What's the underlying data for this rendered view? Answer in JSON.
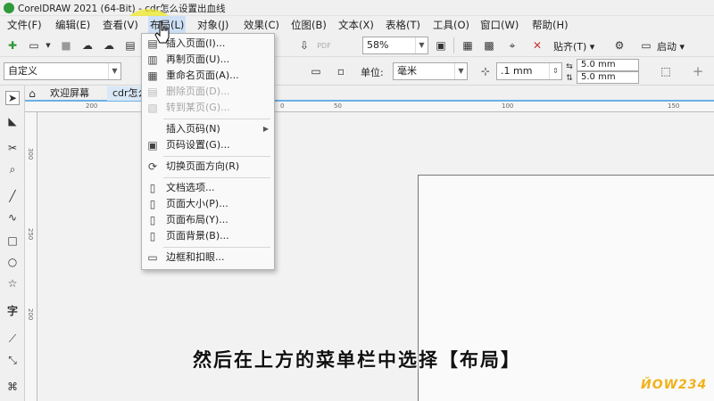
{
  "app": {
    "title": "CorelDRAW 2021 (64-Bit) - cdr怎么设置出血线"
  },
  "menu": {
    "items": [
      "文件(F)",
      "编辑(E)",
      "查看(V)",
      "布局(L)",
      "对象(J)",
      "效果(C)",
      "位图(B)",
      "文本(X)",
      "表格(T)",
      "工具(O)",
      "窗口(W)",
      "帮助(H)"
    ],
    "active_index": 3
  },
  "toolbar": {
    "zoom": "58%",
    "snap_label": "贴齐(T)",
    "launch_label": "启动"
  },
  "property_bar": {
    "page_size": "自定义",
    "unit_label": "单位:",
    "unit_value": "毫米",
    "nudge": ".1 mm",
    "dup_x": "5.0 mm",
    "dup_y": "5.0 mm"
  },
  "doc_tabs": {
    "welcome": "欢迎屏幕",
    "current": "cdr怎么"
  },
  "rulers": {
    "h_labels": [
      "200",
      "0",
      "50",
      "100",
      "150"
    ],
    "v_labels": [
      "300",
      "250",
      "200"
    ]
  },
  "layout_menu": {
    "items": [
      {
        "label": "插入页面(I)...",
        "icon": "insert-page-icon",
        "disabled": false
      },
      {
        "label": "再制页面(U)...",
        "icon": "duplicate-page-icon",
        "disabled": false
      },
      {
        "label": "重命名页面(A)...",
        "icon": "rename-page-icon",
        "disabled": false
      },
      {
        "label": "删除页面(D)...",
        "icon": "delete-page-icon",
        "disabled": true
      },
      {
        "label": "转到某页(G)...",
        "icon": "goto-page-icon",
        "disabled": true
      },
      {
        "label": "插入页码(N)",
        "icon": "",
        "disabled": false,
        "submenu": true
      },
      {
        "label": "页码设置(G)...",
        "icon": "page-number-settings-icon",
        "disabled": false
      },
      {
        "label": "切换页面方向(R)",
        "icon": "switch-orientation-icon",
        "disabled": false
      },
      {
        "label": "文档选项...",
        "icon": "document-options-icon",
        "disabled": false
      },
      {
        "label": "页面大小(P)...",
        "icon": "page-size-icon",
        "disabled": false
      },
      {
        "label": "页面布局(Y)...",
        "icon": "page-layout-icon",
        "disabled": false
      },
      {
        "label": "页面背景(B)...",
        "icon": "page-background-icon",
        "disabled": false
      },
      {
        "label": "边框和扣眼...",
        "icon": "border-grommet-icon",
        "disabled": false
      }
    ]
  },
  "caption": "然后在上方的菜单栏中选择【布局】",
  "watermark": "ЙOW234",
  "colors": {
    "highlight": "#eee828",
    "ruler_accent": "#6ab0e6",
    "corel_green": "#2e9a3a"
  }
}
